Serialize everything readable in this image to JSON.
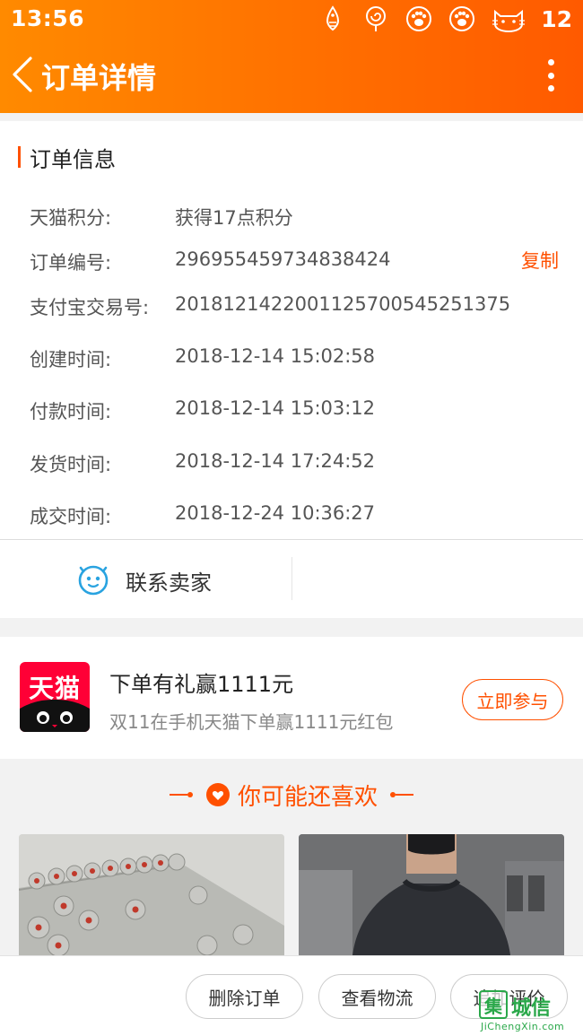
{
  "status_bar": {
    "time": "13:56",
    "battery": "12",
    "icons": [
      "fish-icon",
      "lollipop-icon",
      "paw-icon",
      "paw-icon",
      "cat-icon"
    ]
  },
  "app_bar": {
    "title": "订单详情",
    "back_icon": "chevron-left-icon",
    "more_icon": "more-vertical-icon",
    "background_colors": [
      "#ff8a00",
      "#ff5a00"
    ]
  },
  "order_info": {
    "section_title": "订单信息",
    "accent_color": "#ff5000",
    "rows": [
      {
        "label": "天猫积分:",
        "value": "获得17点积分"
      },
      {
        "label": "订单编号:",
        "value": "296955459734838424",
        "action": "复制"
      },
      {
        "label": "支付宝交易号:",
        "value": "2018121422001125700545251375"
      },
      {
        "label": "创建时间:",
        "value": "2018-12-14 15:02:58"
      },
      {
        "label": "付款时间:",
        "value": "2018-12-14 15:03:12"
      },
      {
        "label": "发货时间:",
        "value": "2018-12-14 17:24:52"
      },
      {
        "label": "成交时间:",
        "value": "2018-12-24 10:36:27"
      }
    ],
    "contact_seller": "联系卖家",
    "contact_icon_color": "#29a3e0"
  },
  "promo": {
    "logo_text": "天猫",
    "logo_color": "#ff0036",
    "title": "下单有礼赢1111元",
    "subtitle": "双11在手机天猫下单赢1111元红包",
    "button": "立即参与"
  },
  "recommend": {
    "title": "你可能还喜欢",
    "products": [
      {
        "name": "chinese-chess-product",
        "image": "chinese-chess-board"
      },
      {
        "name": "sweater-product",
        "image": "man-in-dark-sweater"
      }
    ]
  },
  "actions": {
    "delete": "删除订单",
    "logistics": "查看物流",
    "review": "追加评价"
  },
  "watermark": {
    "box_char": "集",
    "text": "城信",
    "url": "JiChengXin.com"
  }
}
